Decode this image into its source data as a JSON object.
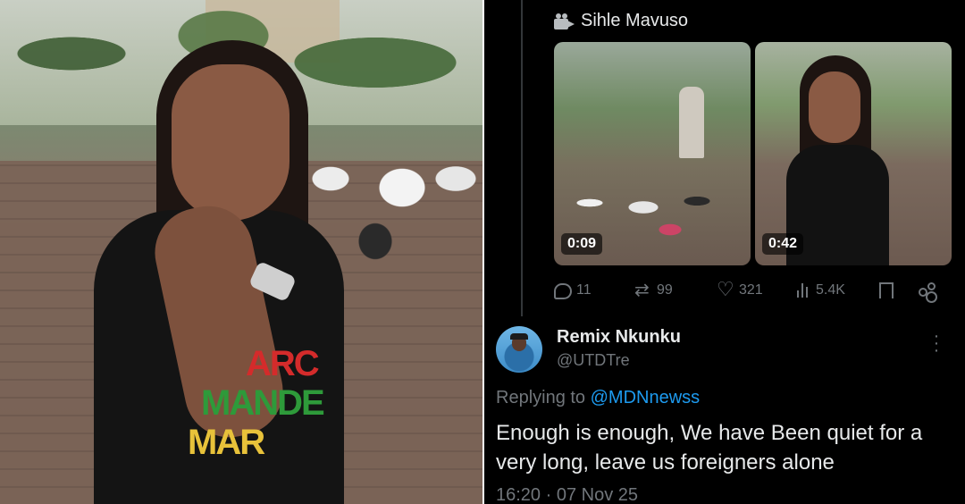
{
  "video_attribution": "Sihle Mavuso",
  "media": [
    {
      "duration": "0:09"
    },
    {
      "duration": "0:42"
    }
  ],
  "shirt_print": [
    "ARC",
    "MANDE",
    "MAR"
  ],
  "metrics": {
    "replies": "11",
    "reposts": "99",
    "likes": "321",
    "views": "5.4K"
  },
  "reply_tweet": {
    "author_name": "Remix Nkunku",
    "author_handle": "@UTDTre",
    "replying_prefix": "Replying to",
    "replying_to": "@MDNnewss",
    "text": "Enough is enough, We have Been quiet for a very long, leave us foreigners alone",
    "timestamp": "16:20 · 07 Nov 25"
  },
  "colors": {
    "background": "#000000",
    "text_primary": "#e7e9ea",
    "text_secondary": "#71767b",
    "accent": "#1d9bf0"
  }
}
